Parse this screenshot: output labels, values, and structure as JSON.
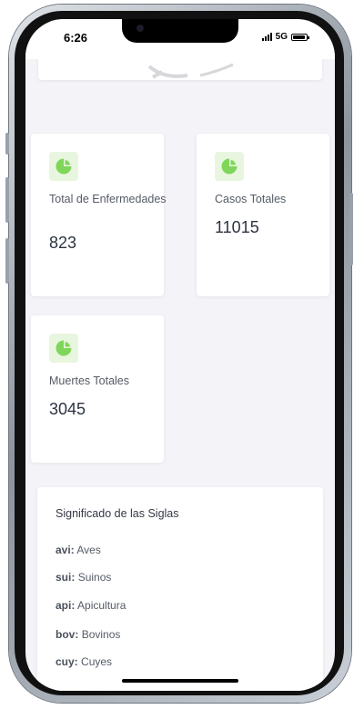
{
  "status_bar": {
    "time": "6:26",
    "network": "5G",
    "battery_level": 0.9
  },
  "stats": [
    {
      "label": "Total de Enfermedades",
      "value": "823",
      "icon": "pie-chart-icon"
    },
    {
      "label": "Casos Totales",
      "value": "11015",
      "icon": "pie-chart-icon"
    },
    {
      "label": "Muertes Totales",
      "value": "3045",
      "icon": "pie-chart-icon"
    }
  ],
  "legend": {
    "title": "Significado de las Siglas",
    "items": [
      {
        "abbr": "avi:",
        "meaning": "Aves"
      },
      {
        "abbr": "sui:",
        "meaning": "Suinos"
      },
      {
        "abbr": "api:",
        "meaning": "Apicultura"
      },
      {
        "abbr": "bov:",
        "meaning": "Bovinos"
      },
      {
        "abbr": "cuy:",
        "meaning": "Cuyes"
      }
    ]
  },
  "colors": {
    "icon_bg": "#e8f6df",
    "icon_fg": "#7fd65a",
    "page_bg": "#f4f4f8"
  }
}
